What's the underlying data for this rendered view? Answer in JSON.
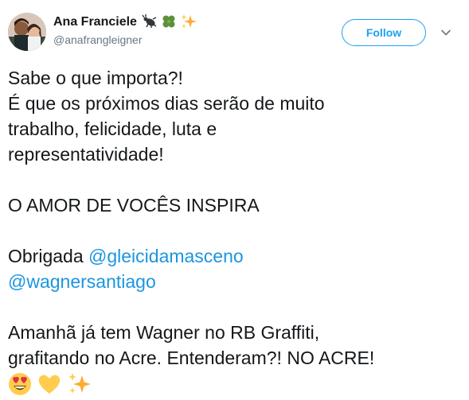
{
  "user": {
    "display_name": "Ana Franciele",
    "handle": "@anafrangleigner",
    "name_emojis": [
      "bug-emoji",
      "four-leaf-clover-emoji",
      "sparkles-emoji"
    ]
  },
  "follow_button": {
    "label": "Follow"
  },
  "tweet": {
    "lines": [
      "Sabe o que importa?!",
      "É que os próximos dias serão de muito",
      "trabalho, felicidade, luta e",
      "representatividade!"
    ],
    "shout": "O AMOR DE VOCÊS INSPIRA",
    "thanks_prefix": "Obrigada ",
    "mentions": [
      "@gleicidamasceno",
      "@wagnersantiago"
    ],
    "closing_lines": [
      "Amanhã já tem Wagner no RB Graffiti,",
      "grafitando no Acre. Entenderam?! NO ACRE!"
    ],
    "ending_emojis": [
      "heart-eyes-emoji",
      "yellow-heart-emoji",
      "sparkles-emoji"
    ]
  },
  "colors": {
    "text": "#14171a",
    "secondary": "#657786",
    "link": "#1b95e0",
    "follow_border": "#1da1f2"
  }
}
